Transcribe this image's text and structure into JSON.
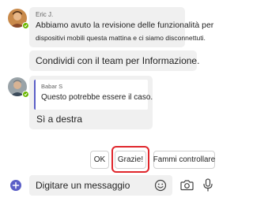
{
  "messages": [
    {
      "sender": "Eric J.",
      "lines": [
        "Abbiamo avuto la revisione delle funzionalità per",
        "dispositivi mobili questa mattina e ci siamo disconnettuti."
      ]
    },
    {
      "text": "Condividi con il team per Informazione."
    },
    {
      "quote_sender": "Babar S",
      "quote_text": "Questo potrebbe essere il caso.",
      "text": "Sì a destra"
    }
  ],
  "suggested_replies": [
    "OK",
    "Grazie!",
    "Fammi controllare"
  ],
  "compose": {
    "placeholder": "Digitare un messaggio"
  },
  "colors": {
    "accent": "#5b5fc7",
    "presence": "#6bb700",
    "highlight": "#e0262c",
    "bubble": "#f0f0f0"
  },
  "icons": [
    "add-icon",
    "emoji-icon",
    "camera-icon",
    "microphone-icon"
  ]
}
